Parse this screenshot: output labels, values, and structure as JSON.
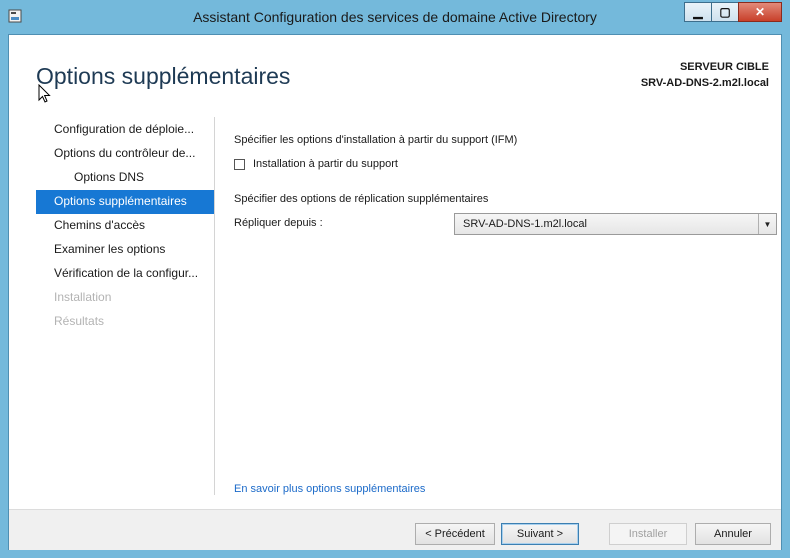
{
  "window": {
    "title": "Assistant Configuration des services de domaine Active Directory",
    "controls": [
      "minimize",
      "maximize",
      "close"
    ]
  },
  "header": {
    "page_title": "Options supplémentaires",
    "target_label": "SERVEUR CIBLE",
    "target_value": "SRV-AD-DNS-2.m2l.local"
  },
  "nav": {
    "items": [
      {
        "label": "Configuration de déploie...",
        "state": "normal"
      },
      {
        "label": "Options du contrôleur de...",
        "state": "normal"
      },
      {
        "label": "Options DNS",
        "state": "sub"
      },
      {
        "label": "Options supplémentaires",
        "state": "active"
      },
      {
        "label": "Chemins d'accès",
        "state": "normal"
      },
      {
        "label": "Examiner les options",
        "state": "normal"
      },
      {
        "label": "Vérification de la configur...",
        "state": "normal"
      },
      {
        "label": "Installation",
        "state": "disabled"
      },
      {
        "label": "Résultats",
        "state": "disabled"
      }
    ]
  },
  "content": {
    "ifm_heading": "Spécifier les options d'installation à partir du support (IFM)",
    "ifm_checkbox_label": "Installation à partir du support",
    "ifm_checked": false,
    "replication_heading": "Spécifier des options de réplication supplémentaires",
    "replicate_label": "Répliquer depuis :",
    "replicate_value": "SRV-AD-DNS-1.m2l.local",
    "more_link": "En savoir plus options supplémentaires"
  },
  "footer": {
    "previous": "< Précédent",
    "next": "Suivant >",
    "install": "Installer",
    "cancel": "Annuler"
  },
  "colors": {
    "titlebar": "#74b9db",
    "nav_active": "#1778d4",
    "link": "#1b6ac9",
    "heading": "#1e3a54"
  }
}
